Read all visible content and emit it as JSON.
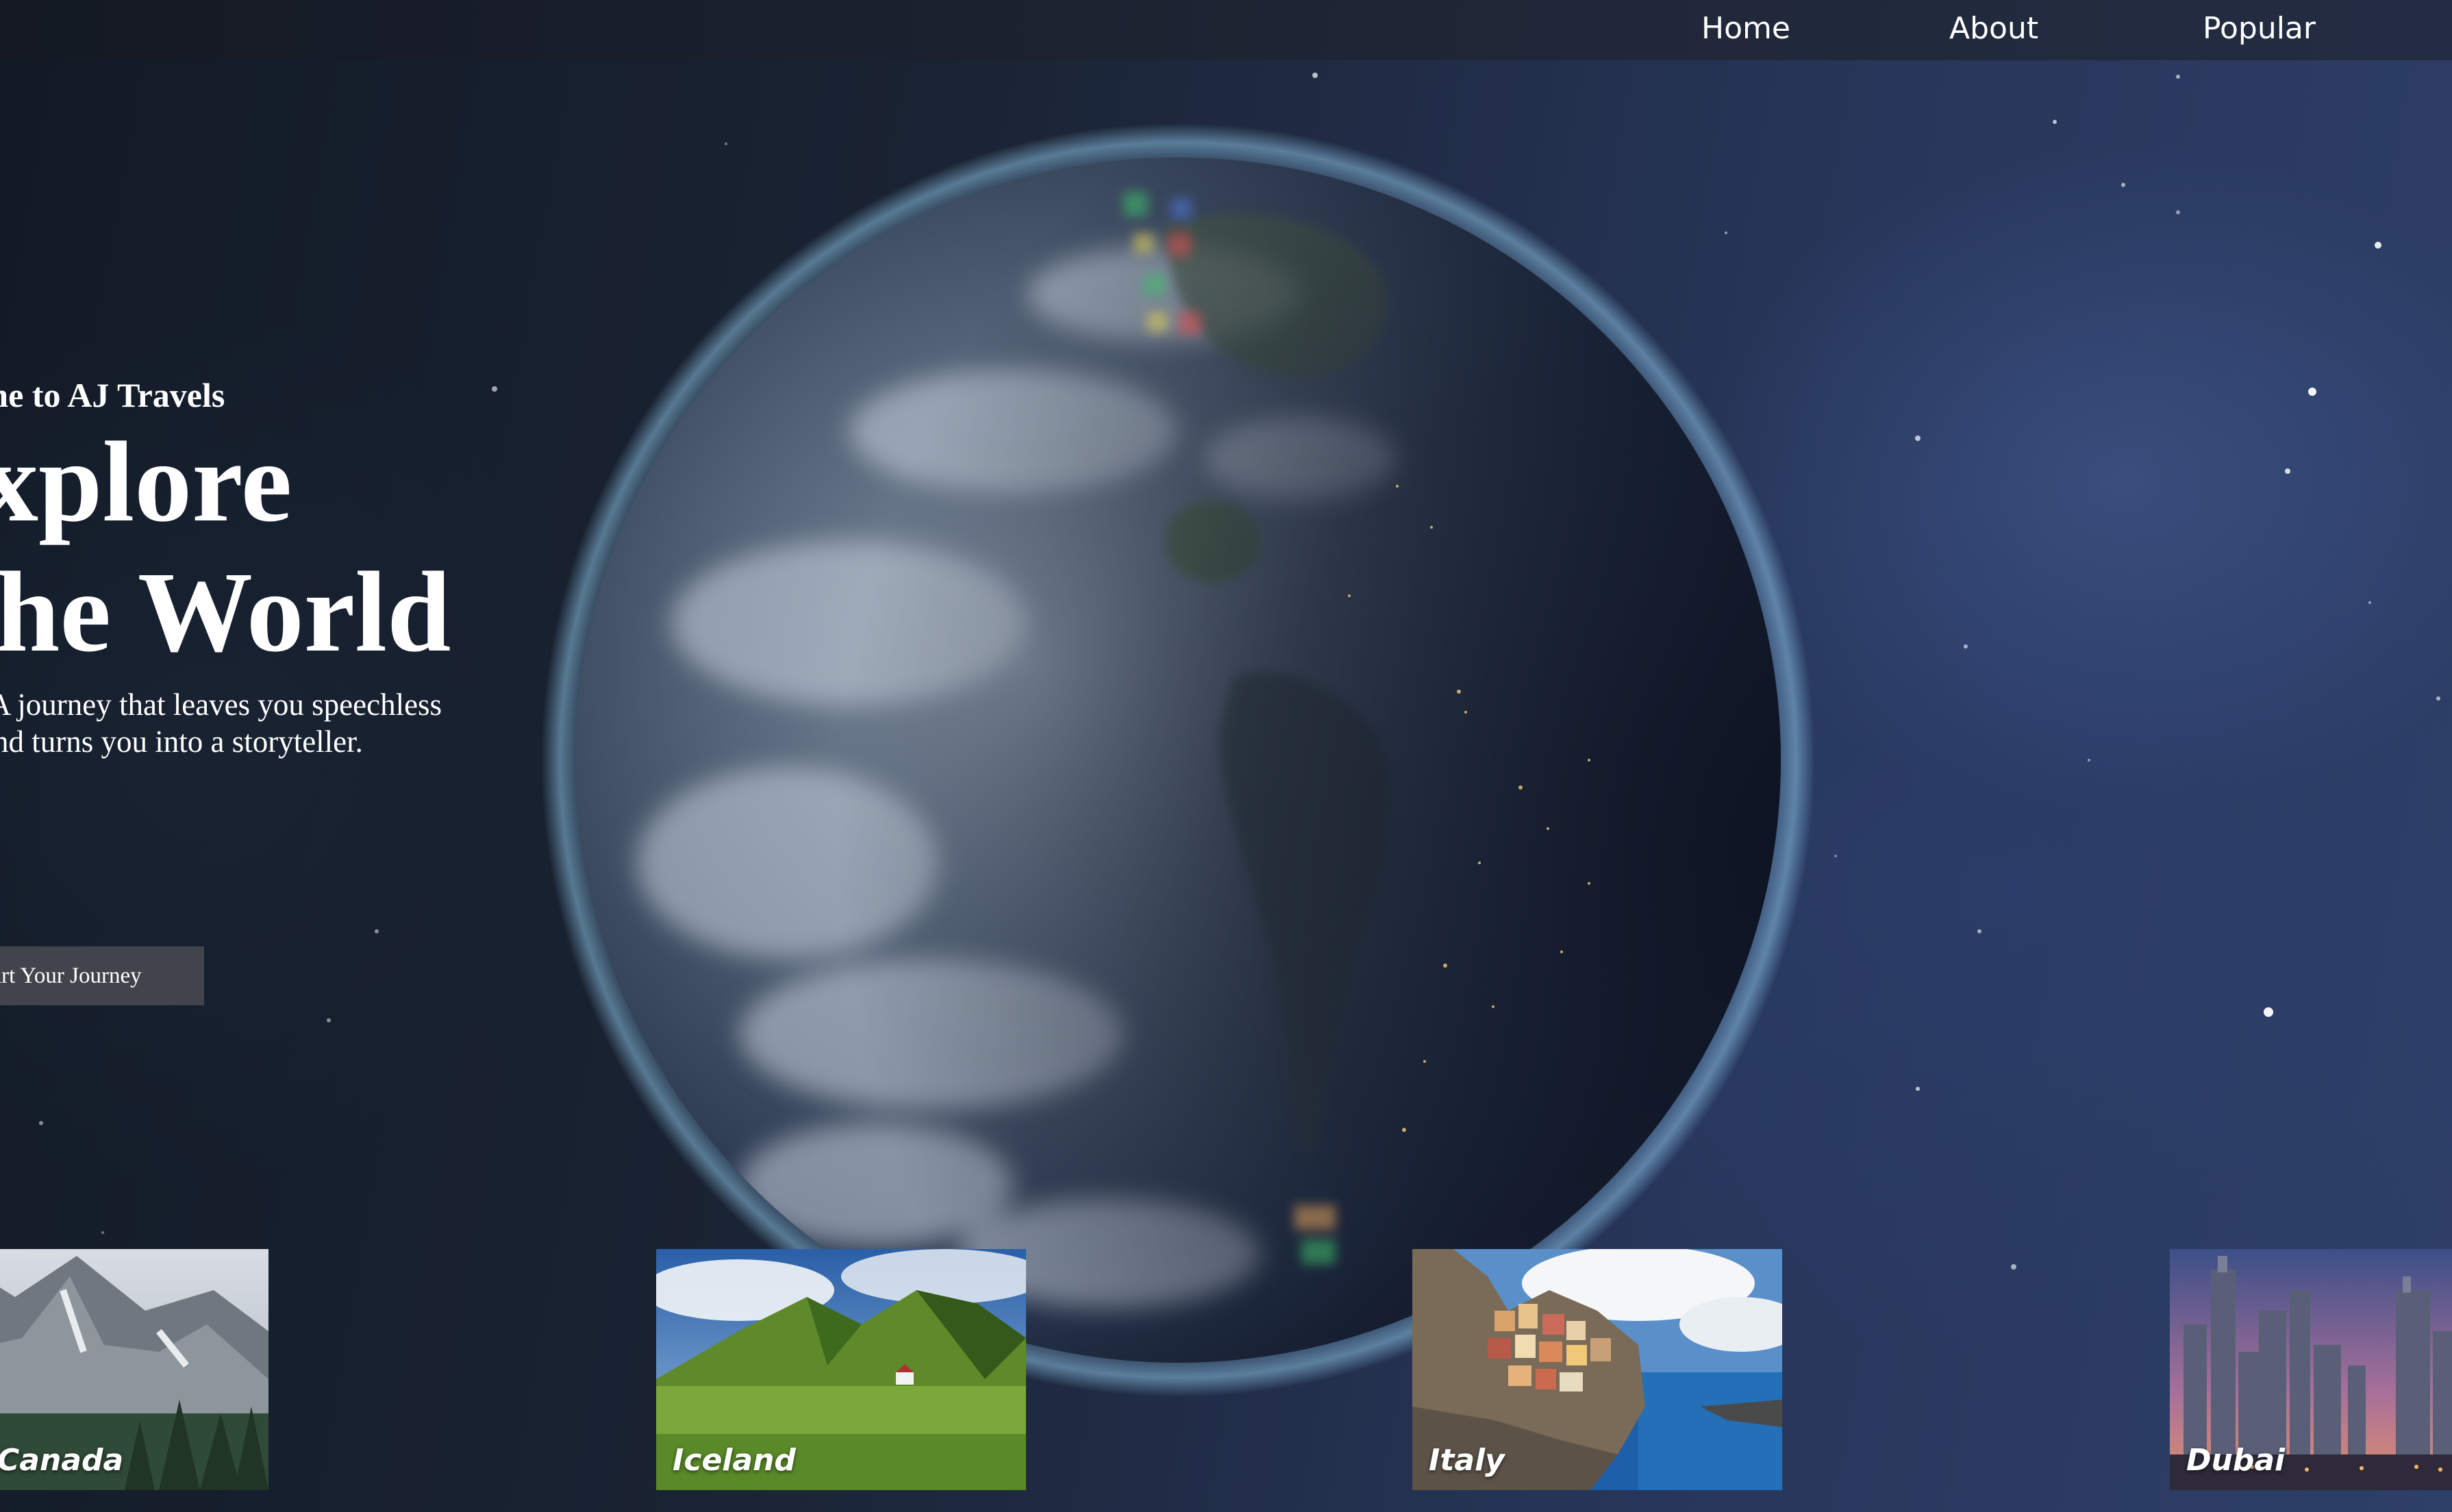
{
  "nav": {
    "home_label": "Home",
    "about_label": "About",
    "popular_label": "Popular"
  },
  "hero": {
    "welcome": "Welcome to AJ Travels",
    "title_line1": "Explore",
    "title_line2": "The World",
    "subtitle_line1": "A journey that leaves you speechless",
    "subtitle_line2": "and turns you into a storyteller.",
    "cta_label": "Start Your Journey"
  },
  "destinations": [
    {
      "name": "Canada",
      "icon": "mountain-photo"
    },
    {
      "name": "Iceland",
      "icon": "green-hills-photo"
    },
    {
      "name": "Italy",
      "icon": "coastal-village-photo"
    },
    {
      "name": "Dubai",
      "icon": "skyline-photo"
    }
  ],
  "colors": {
    "nav_bg": "#1e2432",
    "button_bg": "#46484e",
    "text": "#ffffff"
  }
}
